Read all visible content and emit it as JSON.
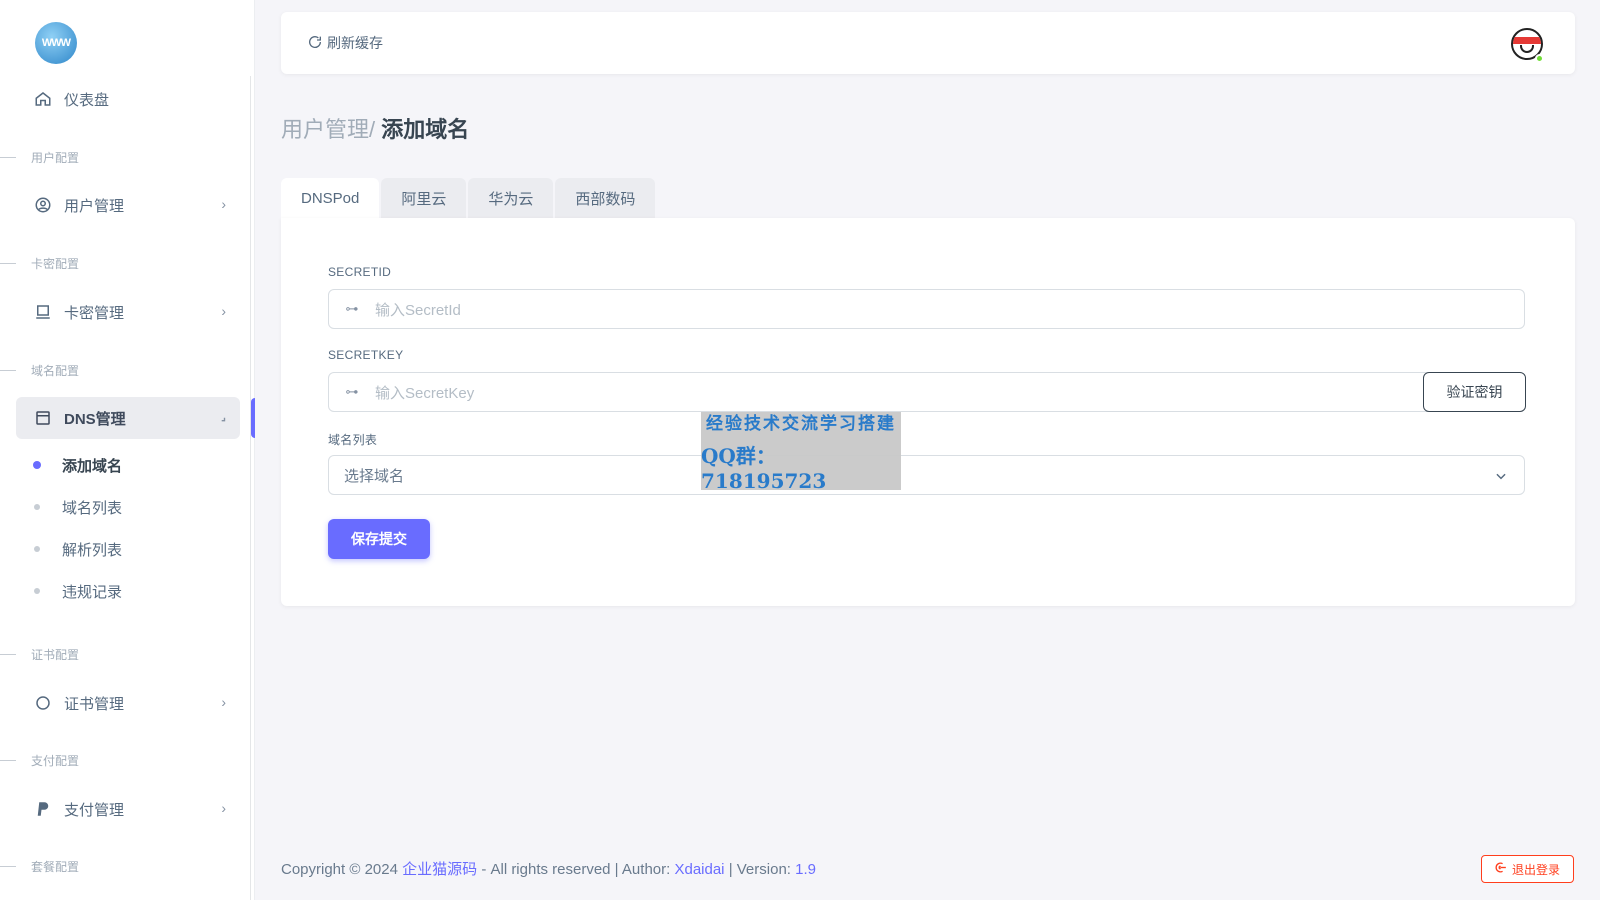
{
  "sidebar": {
    "logo_text": "WWW",
    "dashboard": "仪表盘",
    "sections": {
      "user": "用户配置",
      "card": "卡密配置",
      "domain": "域名配置",
      "cert": "证书配置",
      "pay": "支付配置",
      "package": "套餐配置"
    },
    "items": {
      "user_mgmt": "用户管理",
      "card_mgmt": "卡密管理",
      "dns_mgmt": "DNS管理",
      "cert_mgmt": "证书管理",
      "pay_mgmt": "支付管理"
    },
    "dns_sub": [
      "添加域名",
      "域名列表",
      "解析列表",
      "违规记录"
    ]
  },
  "topbar": {
    "refresh_label": "刷新缓存"
  },
  "breadcrumb": {
    "parent": "用户管理/",
    "current": "添加域名"
  },
  "tabs": [
    "DNSPod",
    "阿里云",
    "华为云",
    "西部数码"
  ],
  "form": {
    "secretid_label": "SECRETID",
    "secretid_placeholder": "输入SecretId",
    "secretkey_label": "SECRETKEY",
    "secretkey_placeholder": "输入SecretKey",
    "verify_button": "验证密钥",
    "domain_list_label": "域名列表",
    "domain_select_value": "选择域名",
    "save_button": "保存提交"
  },
  "watermark": {
    "line1": "经验技术交流学习搭建",
    "line2": "QQ群：718195723"
  },
  "footer": {
    "copyright": "Copyright © 2024",
    "brand": "企业猫源码",
    "rights": "- All rights reserved | Author:",
    "author": "Xdaidai",
    "version_label": "| Version:",
    "version": "1.9"
  },
  "logout_label": "退出登录",
  "colors": {
    "primary": "#696cff",
    "danger": "#ff3e1d",
    "online": "#71dd37"
  }
}
